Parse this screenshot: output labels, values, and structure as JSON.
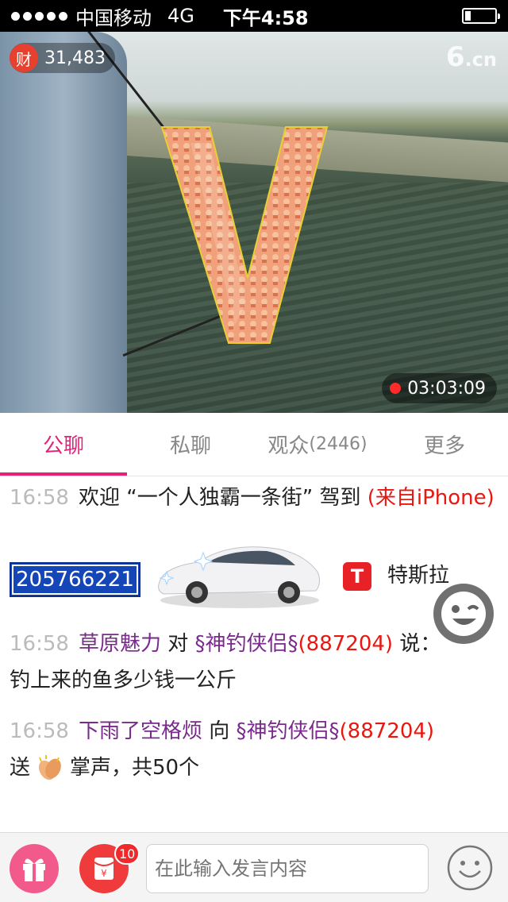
{
  "status_bar": {
    "carrier": "中国移动",
    "network": "4G",
    "time": "下午4:58",
    "battery_level": 0.2
  },
  "video": {
    "wealth_label": "财",
    "wealth_count": "31,483",
    "logo": "6",
    "logo_suffix": ".cn",
    "live_duration": "03:03:09"
  },
  "tabs": [
    {
      "label": "公聊"
    },
    {
      "label": "私聊"
    },
    {
      "label": "观众",
      "count": "(2446)"
    },
    {
      "label": "更多"
    }
  ],
  "chat": {
    "welcome": {
      "time": "16:58",
      "prefix": "欢迎",
      "user": "“一个人独霸一条街”",
      "action": "驾到",
      "source": "(来自iPhone)"
    },
    "car_gift": {
      "user_id": "205766221",
      "car_name": "特斯拉",
      "brand_logo": "T"
    },
    "msg1": {
      "time": "16:58",
      "from": "草原魅力",
      "mid": "对",
      "to": "§神钓侠侣§",
      "to_id": "(887204)",
      "say": "说：",
      "text": "钓上来的鱼多少钱一公斤"
    },
    "msg2": {
      "time": "16:58",
      "from": "下雨了空格烦",
      "mid": "向",
      "to": "§神钓侠侣§",
      "to_id": "(887204)",
      "send": "送",
      "gift_text": "掌声，共50个"
    }
  },
  "bottom_bar": {
    "redpack_badge": "10",
    "input_placeholder": "在此输入发言内容"
  },
  "colors": {
    "accent": "#e4227a",
    "timer_dot": "#ff2a2a",
    "user_purple": "#7a2a8c",
    "source_red": "#e8170f"
  }
}
